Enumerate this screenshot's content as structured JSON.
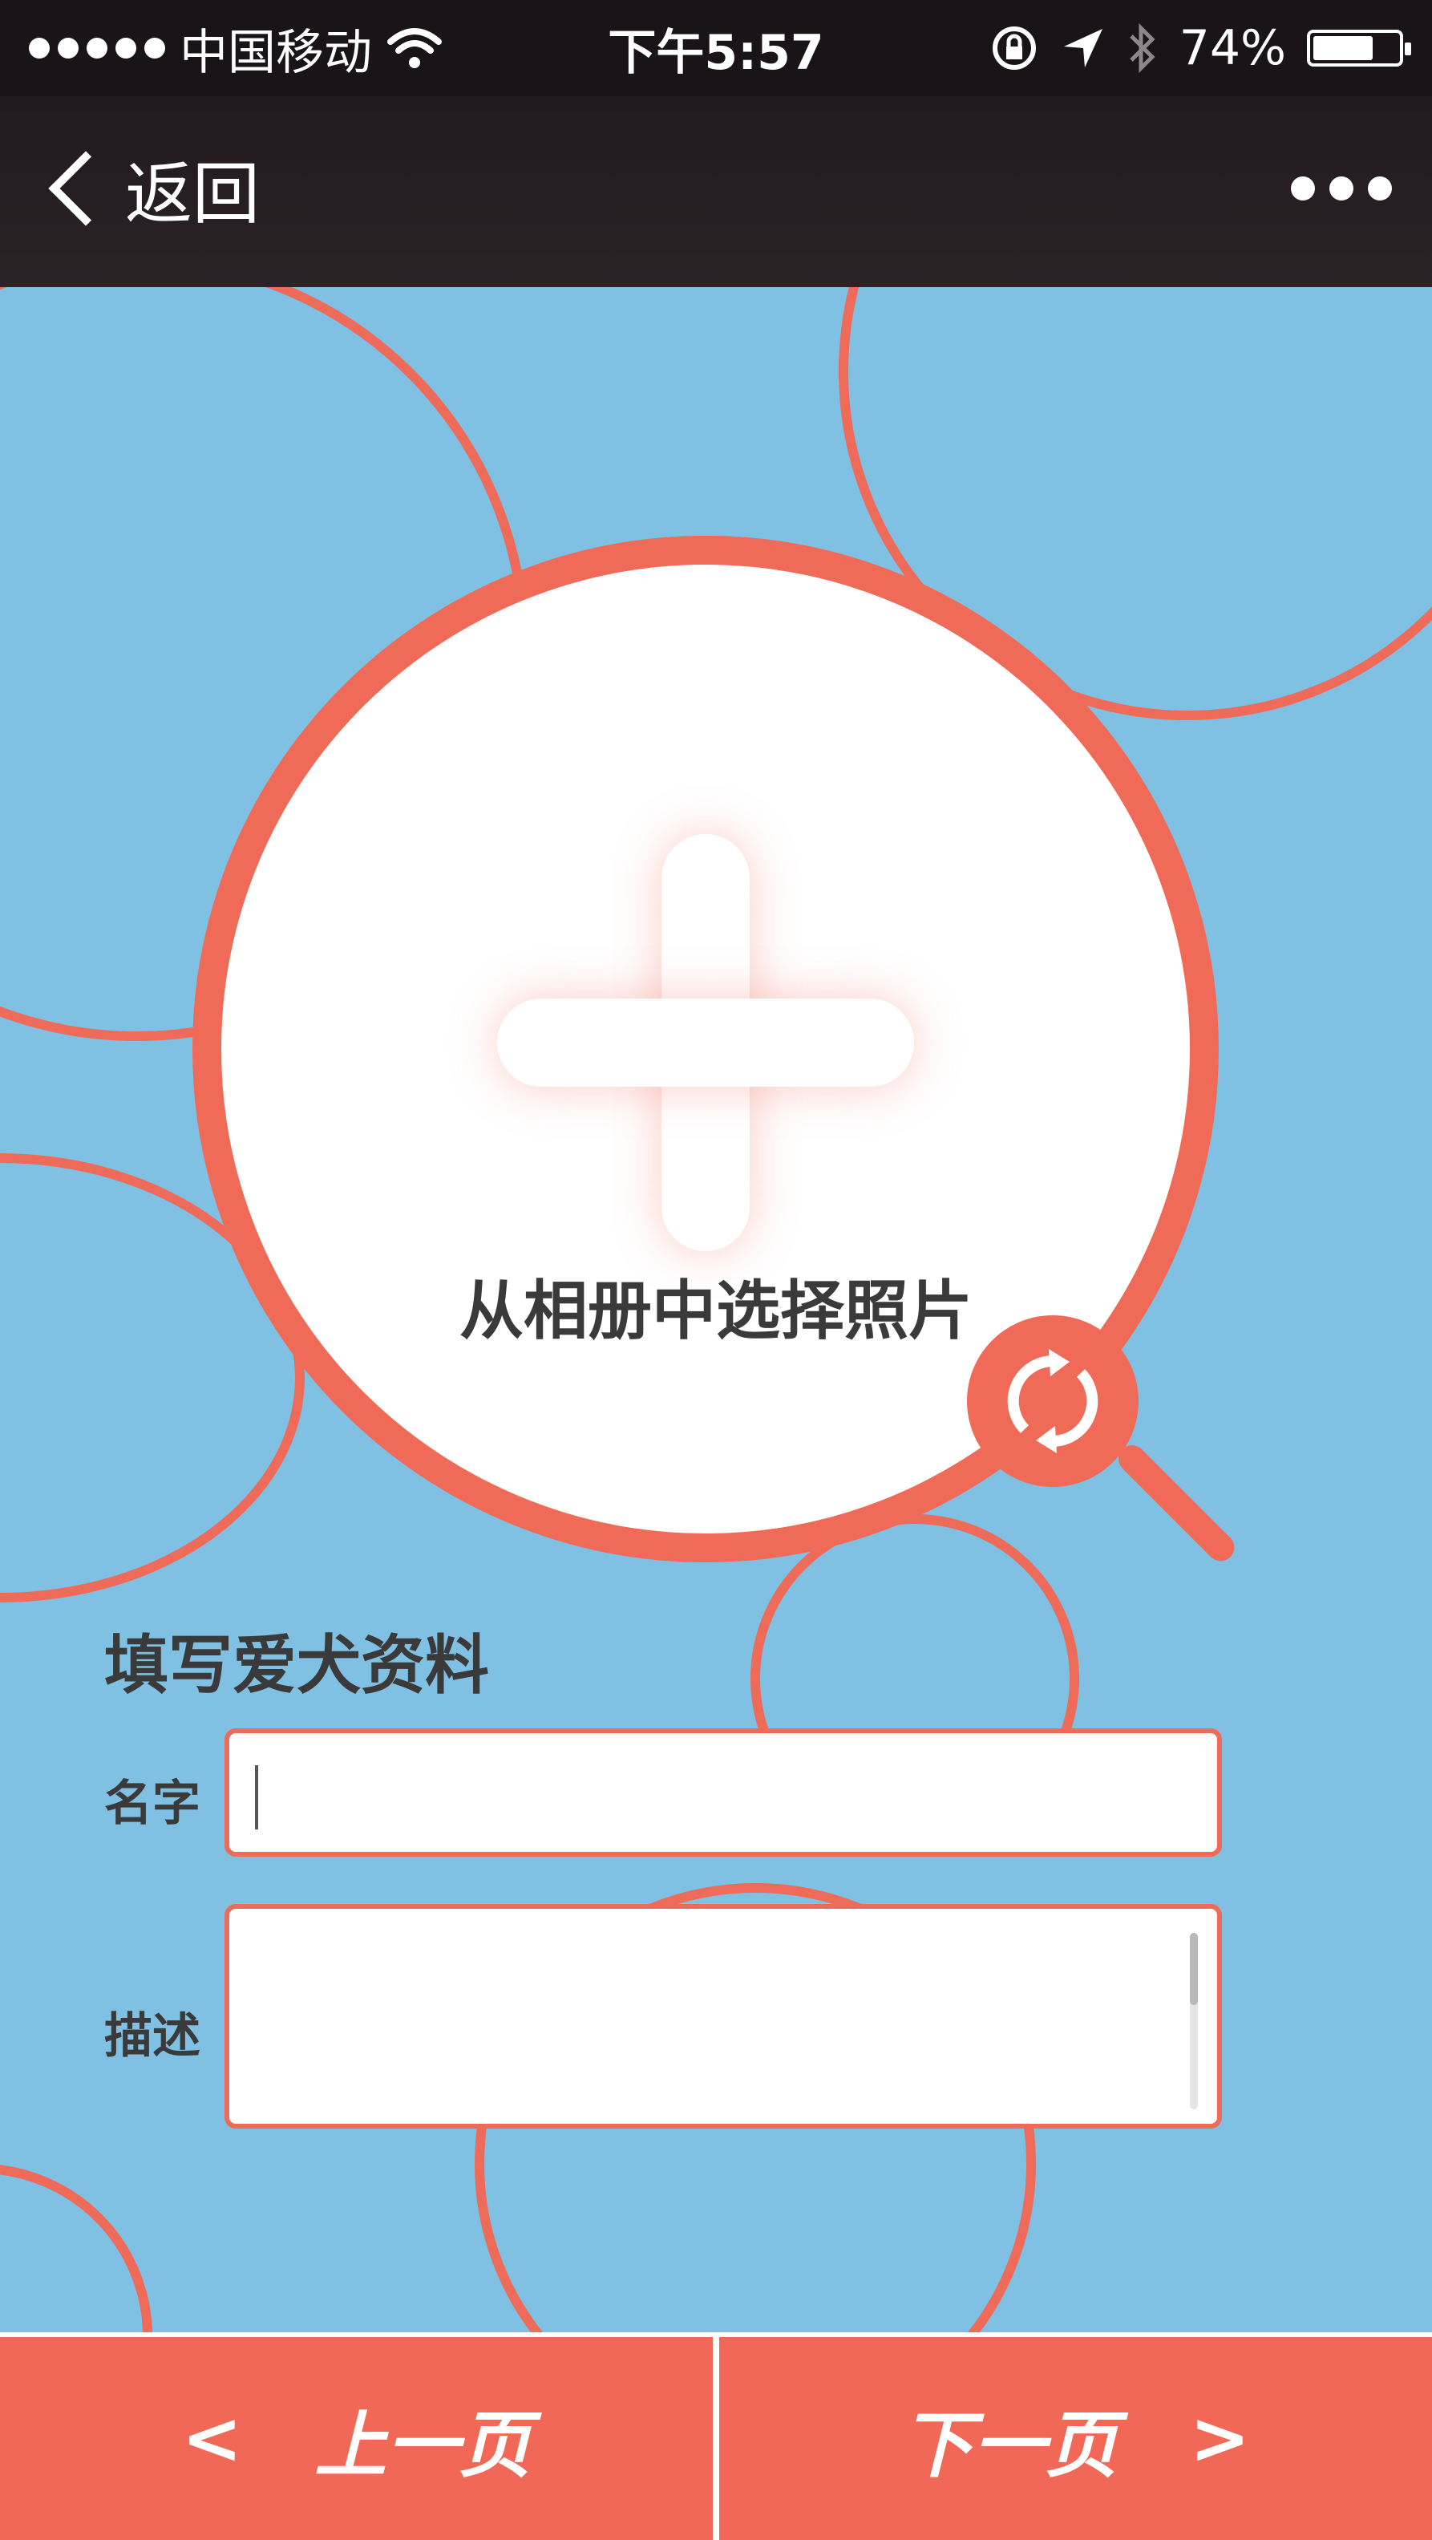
{
  "status_bar": {
    "carrier": "中国移动",
    "time": "下午5:57",
    "battery": "74%",
    "battery_level": 0.74,
    "signal_dots": 5
  },
  "nav": {
    "back_label": "返回"
  },
  "picker": {
    "label": "从相册中选择照片"
  },
  "form": {
    "title": "填写爱犬资料",
    "name_label": "名字",
    "name_value": "",
    "desc_label": "描述",
    "desc_value": ""
  },
  "footer": {
    "prev_label": "上一页",
    "next_label": "下一页"
  },
  "colors": {
    "accent": "#f16857",
    "background": "#80c0e3",
    "topbar": "#1a1418"
  },
  "icons": [
    "wifi-icon",
    "orientation-lock-icon",
    "location-arrow-icon",
    "bluetooth-icon",
    "battery-icon",
    "back-chevron-icon",
    "more-dots-icon",
    "plus-icon",
    "refresh-magnifier-icon"
  ]
}
